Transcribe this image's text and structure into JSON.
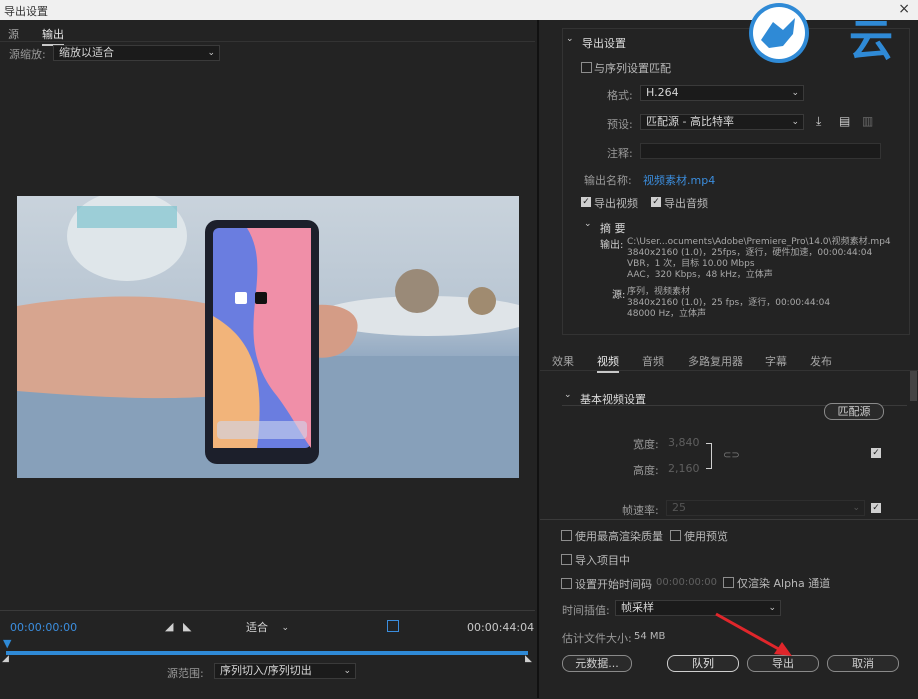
{
  "window": {
    "title": "导出设置",
    "close": "×"
  },
  "left": {
    "tabs": [
      {
        "label": "源"
      },
      {
        "label": "输出"
      }
    ],
    "zoom_label": "源缩放:",
    "zoom_value": "缩放以适合",
    "timecode_start": "00:00:00:00",
    "timecode_end": "00:00:44:04",
    "fit_value": "适合",
    "range_label": "源范围:",
    "range_value": "序列切入/序列切出"
  },
  "export": {
    "header": "导出设置",
    "match_sequence": "与序列设置匹配",
    "format_label": "格式:",
    "format_value": "H.264",
    "preset_label": "预设:",
    "preset_value": "匹配源 - 高比特率",
    "comment_label": "注释:",
    "output_name_label": "输出名称:",
    "output_name_value": "视频素材.mp4",
    "export_video": "导出视频",
    "export_audio": "导出音频",
    "summary_header": "摘 要",
    "output_label": "输出:",
    "output_lines": [
      "C:\\User...ocuments\\Adobe\\Premiere_Pro\\14.0\\视频素材.mp4",
      "3840x2160 (1.0)，25fps，逐行，硬件加速，00:00:44:04",
      "VBR，1 次，目标 10.00 Mbps",
      "AAC，320 Kbps，48 kHz，立体声"
    ],
    "source_label": "源:",
    "source_lines": [
      "序列，视频素材",
      "3840x2160 (1.0)，25 fps，逐行，00:00:44:04",
      "48000 Hz，立体声"
    ]
  },
  "settings_tabs": [
    {
      "label": "效果"
    },
    {
      "label": "视频"
    },
    {
      "label": "音频"
    },
    {
      "label": "多路复用器"
    },
    {
      "label": "字幕"
    },
    {
      "label": "发布"
    }
  ],
  "video": {
    "section": "基本视频设置",
    "match_source": "匹配源",
    "width_label": "宽度:",
    "width_value": "3,840",
    "height_label": "高度:",
    "height_value": "2,160",
    "fps_label": "帧速率:",
    "fps_value": "25"
  },
  "bottom": {
    "max_quality": "使用最高渲染质量",
    "use_preview": "使用预览",
    "import_project": "导入项目中",
    "set_start_tc": "设置开始时间码",
    "start_tc_value": "00:00:00:00",
    "render_alpha": "仅渲染 Alpha 通道",
    "interp_label": "时间插值:",
    "interp_value": "帧采样",
    "est_size_label": "估计文件大小:",
    "est_size_value": "54 MB",
    "metadata_btn": "元数据...",
    "queue_btn": "队列",
    "export_btn": "导出",
    "cancel_btn": "取消"
  },
  "watermark": {
    "text": "云"
  },
  "colors": {
    "accent": "#3b8ddd",
    "playhead": "#2f8ad6",
    "arrow": "#e0262b"
  }
}
